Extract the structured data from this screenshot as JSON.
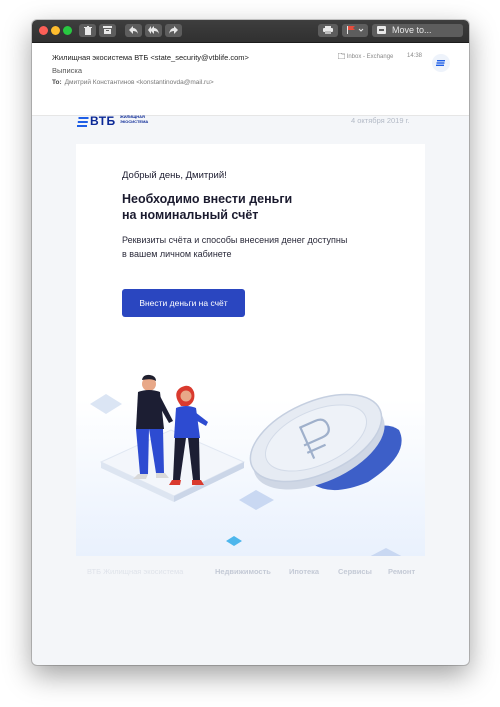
{
  "toolbar": {
    "move_label": "Move to..."
  },
  "email": {
    "from": "Жилищная экосистема ВТБ <state_security@vtblife.com>",
    "subject": "Выписка",
    "to_label": "To:",
    "to": "Дмитрий Константинов <konstantinovda@mail.ru>",
    "folder": "Inbox - Exchange",
    "time": "14:38"
  },
  "message": {
    "logo_text": "ВТБ",
    "logo_subtitle": "ЖИЛИЩНАЯ ЭКОСИСТЕМА",
    "date": "4 октября 2019 г.",
    "greeting": "Добрый день, Дмитрий!",
    "headline_line1": "Необходимо внести деньги",
    "headline_line2": "на номинальный счёт",
    "subtext_line1": "Реквизиты счёта и способы внесения денег доступны",
    "subtext_line2": "в вашем личном кабинете",
    "cta_label": "Внести деньги на счёт"
  },
  "footer": {
    "brand": "ВТБ Жилищная экосистема",
    "links": [
      "Недвижимость",
      "Ипотека",
      "Сервисы",
      "Ремонт"
    ]
  },
  "colors": {
    "accent": "#2a46c0",
    "brand": "#0a2896"
  }
}
